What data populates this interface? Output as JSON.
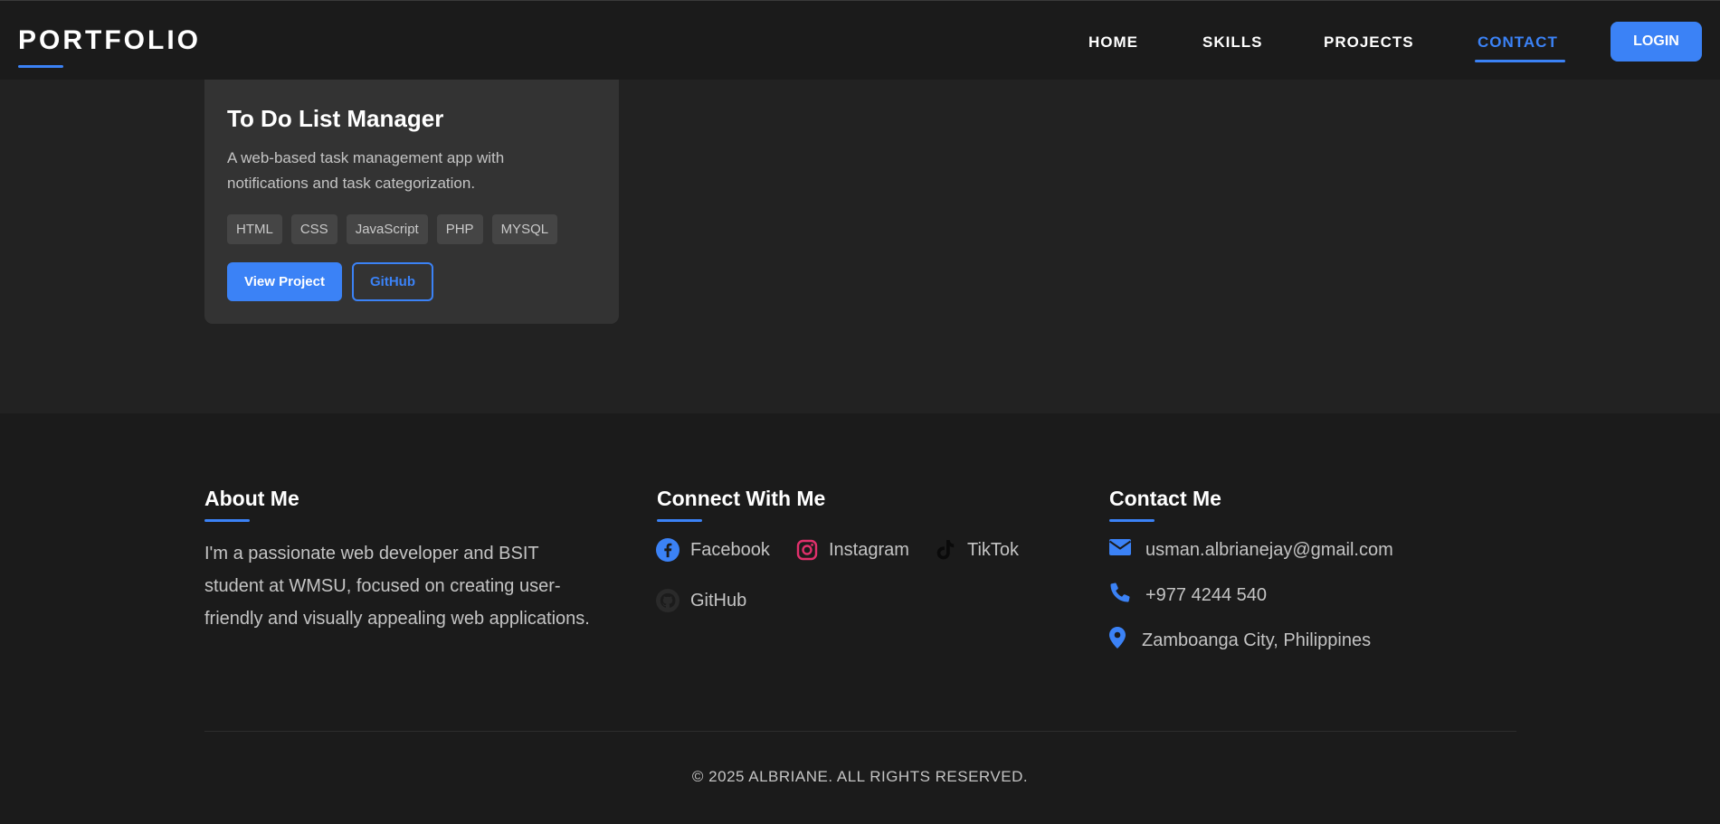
{
  "header": {
    "logo": "PORTFOLIO",
    "nav": [
      {
        "label": "HOME"
      },
      {
        "label": "SKILLS"
      },
      {
        "label": "PROJECTS"
      },
      {
        "label": "CONTACT",
        "active": true
      }
    ],
    "login_label": "LOGIN"
  },
  "project": {
    "title": "To Do List Manager",
    "description": "A web-based task management app with notifications and task categorization.",
    "tags": [
      "HTML",
      "CSS",
      "JavaScript",
      "PHP",
      "MYSQL"
    ],
    "view_label": "View Project",
    "github_label": "GitHub"
  },
  "footer": {
    "about": {
      "heading": "About Me",
      "text": "I'm a passionate web developer and BSIT student at WMSU, focused on creating user-friendly and visually appealing web applications."
    },
    "connect": {
      "heading": "Connect With Me",
      "links": [
        {
          "label": "Facebook",
          "icon": "facebook-icon"
        },
        {
          "label": "Instagram",
          "icon": "instagram-icon"
        },
        {
          "label": "TikTok",
          "icon": "tiktok-icon"
        },
        {
          "label": "GitHub",
          "icon": "github-icon"
        }
      ]
    },
    "contact": {
      "heading": "Contact Me",
      "email": "usman.albrianejay@gmail.com",
      "phone": "+977 4244 540",
      "location": "Zamboanga City, Philippines"
    },
    "copyright": "© 2025 ALBRIANE. ALL RIGHTS RESERVED."
  },
  "colors": {
    "accent": "#3b82f6",
    "header_bg": "#1b1b1b",
    "page_bg": "#222222",
    "card_bg": "#333333",
    "instagram": "#e1306c"
  }
}
